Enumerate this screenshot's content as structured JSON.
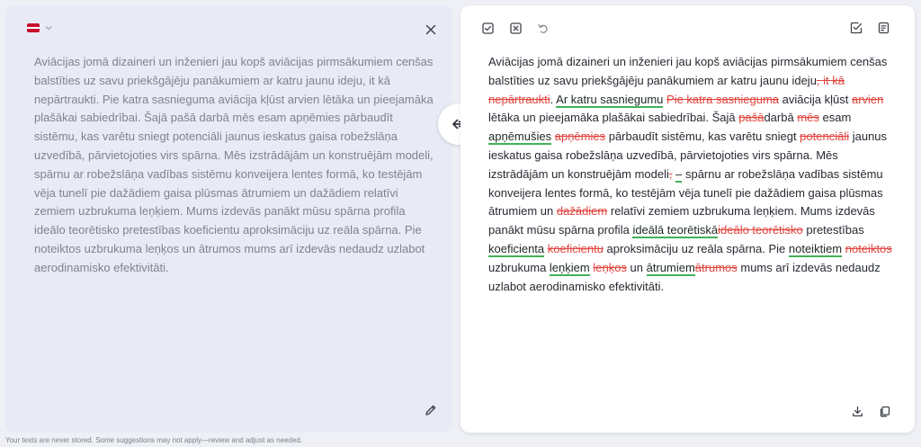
{
  "source": {
    "language_flag": "latvia-flag",
    "text": "Aviācijas jomā dizaineri un inženieri jau kopš aviācijas pirmsākumiem cenšas balstīties uz savu priekšgājēju panākumiem ar katru jaunu ideju, it kā nepārtraukti. Pie katra sasnieguma aviācija kļūst arvien lētāka un pieejamāka plašākai sabiedrībai. Šajā pašā darbā mēs esam apņēmies pārbaudīt sistēmu, kas varētu sniegt potenciāli jaunus ieskatus gaisa robežslāņa uzvedībā, pārvietojoties virs spārna. Mēs izstrādājām un konstruējām modeli, spārnu ar robežslāņa vadības sistēmu konveijera lentes formā, ko testējām vēja tunelī pie dažādiem gaisa plūsmas ātrumiem un dažādiem relatīvi zemiem uzbrukuma leņķiem. Mums izdevās panākt mūsu spārna profila ideālo teorētisko pretestības koeficientu aproksimāciju uz reāla spārna. Pie noteiktos uzbrukuma leņķos un ātrumos mums arī izdevās nedaudz uzlabot aerodinamisko efektivitāti."
  },
  "result": {
    "segments": [
      {
        "t": "Aviācijas jomā dizaineri un inženieri jau kopš aviācijas pirmsākumiem cenšas balstīties uz savu priekšgājēju panākumiem ar katru jaunu ideju",
        "k": "n"
      },
      {
        "t": ", it kā nepārtraukti",
        "k": "d"
      },
      {
        "t": ". ",
        "k": "n"
      },
      {
        "t": "Ar katru sasniegumu",
        "k": "i"
      },
      {
        "t": " ",
        "k": "n"
      },
      {
        "t": "Pie katra sasnieguma",
        "k": "d"
      },
      {
        "t": " aviācija kļūst ",
        "k": "n"
      },
      {
        "t": "arvien",
        "k": "d"
      },
      {
        "t": " lētāka un pieejamāka plašākai sabiedrībai. Šajā ",
        "k": "n"
      },
      {
        "t": "pašā",
        "k": "d"
      },
      {
        "t": "darbā ",
        "k": "n"
      },
      {
        "t": "mēs",
        "k": "d"
      },
      {
        "t": " esam ",
        "k": "n"
      },
      {
        "t": "apņēmušies",
        "k": "i"
      },
      {
        "t": " ",
        "k": "n"
      },
      {
        "t": "apņēmies",
        "k": "d"
      },
      {
        "t": " pārbaudīt sistēmu, kas varētu sniegt ",
        "k": "n"
      },
      {
        "t": "potenciāli",
        "k": "d"
      },
      {
        "t": " jaunus ieskatus gaisa robežslāņa uzvedībā, pārvietojoties virs spārna. Mēs izstrādājām un konstruējām modeli",
        "k": "n"
      },
      {
        "t": ",",
        "k": "d"
      },
      {
        "t": " ",
        "k": "n"
      },
      {
        "t": "–",
        "k": "i"
      },
      {
        "t": " spārnu ar robežslāņa vadības sistēmu konveijera lentes formā, ko testējām vēja tunelī pie dažādiem gaisa plūsmas ātrumiem un ",
        "k": "n"
      },
      {
        "t": "dažādiem",
        "k": "d"
      },
      {
        "t": " relatīvi zemiem uzbrukuma leņķiem. Mums izdevās panākt mūsu spārna profila ",
        "k": "n"
      },
      {
        "t": "ideālā teorētiskā",
        "k": "i"
      },
      {
        "t": "ideālo teorētisko",
        "k": "d"
      },
      {
        "t": " pretestības ",
        "k": "n"
      },
      {
        "t": "koeficienta",
        "k": "i"
      },
      {
        "t": " ",
        "k": "n"
      },
      {
        "t": "koeficientu",
        "k": "d"
      },
      {
        "t": " aproksimāciju uz reāla spārna. Pie ",
        "k": "n"
      },
      {
        "t": "noteiktiem",
        "k": "i"
      },
      {
        "t": " ",
        "k": "n"
      },
      {
        "t": "noteiktos",
        "k": "d"
      },
      {
        "t": " uzbrukuma ",
        "k": "n"
      },
      {
        "t": "leņķiem",
        "k": "i"
      },
      {
        "t": " ",
        "k": "n"
      },
      {
        "t": "leņķos",
        "k": "d"
      },
      {
        "t": " un ",
        "k": "n"
      },
      {
        "t": "ātrumiem",
        "k": "i"
      },
      {
        "t": "ātrumos",
        "k": "d"
      },
      {
        "t": " mums arī izdevās nedaudz uzlabot aerodinamisko efektivitāti.",
        "k": "n"
      }
    ]
  },
  "footer": {
    "note": "Your texts are never stored. Some suggestions may not apply—review and adjust as needed."
  },
  "colors": {
    "insert_underline": "#43b05c",
    "delete_text": "#e0443e",
    "flag_red": "#c8102e"
  }
}
